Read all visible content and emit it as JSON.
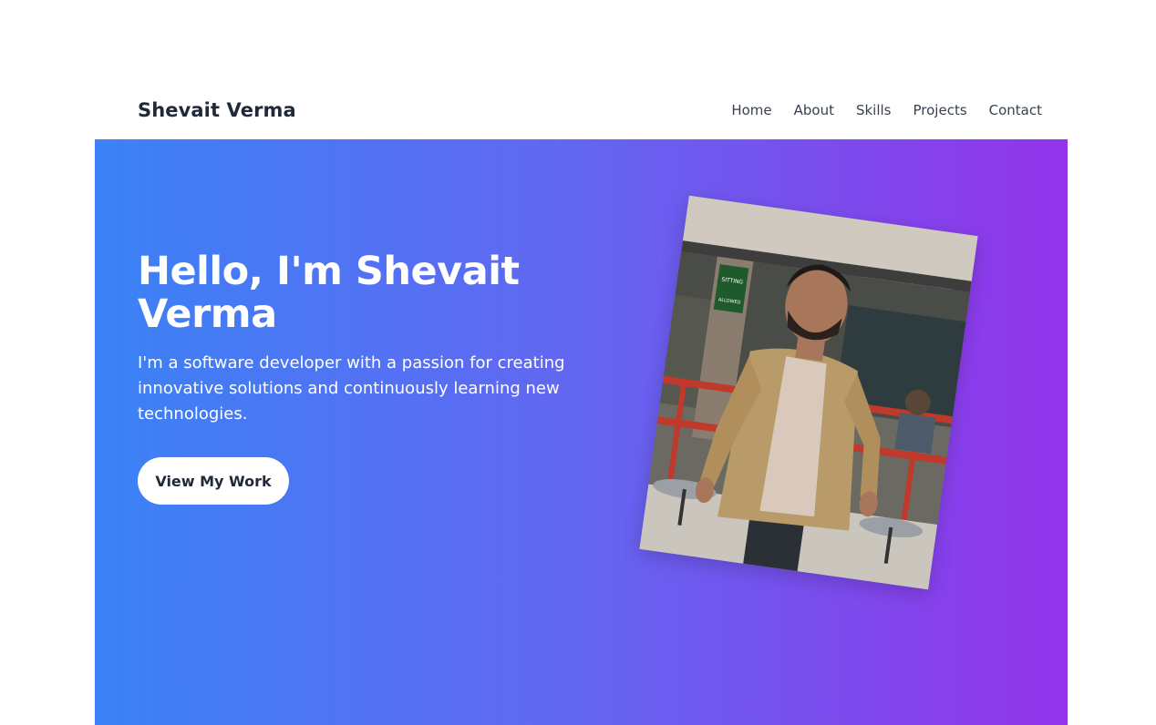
{
  "navbar": {
    "brand": "Shevait Verma",
    "links": [
      "Home",
      "About",
      "Skills",
      "Projects",
      "Contact"
    ]
  },
  "hero": {
    "title": "Hello, I'm Shevait Verma",
    "subtitle": "I'm a software developer with a passion for creating innovative solutions and continuously learning new technologies.",
    "cta_label": "View My Work",
    "photo_sign_text": "SITTING ALLOWED"
  },
  "colors": {
    "gradient_start": "#3b82f6",
    "gradient_mid": "#6366f1",
    "gradient_end": "#9333ea",
    "brand_text": "#1f2937"
  }
}
